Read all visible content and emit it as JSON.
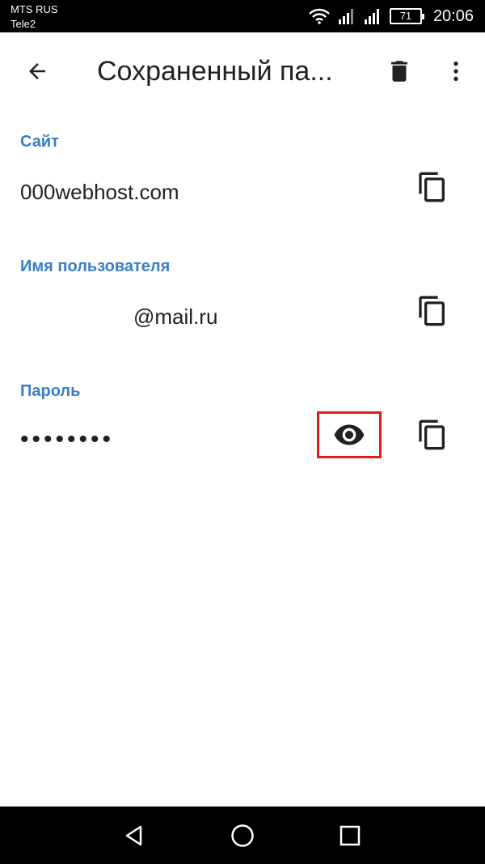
{
  "status_bar": {
    "carrier_primary": "MTS RUS",
    "carrier_secondary": "Tele2",
    "battery_level": "71",
    "time": "20:06",
    "icons": [
      "wifi-icon",
      "signal-icon",
      "signal-icon",
      "battery-icon"
    ]
  },
  "app_bar": {
    "title": "Сохраненный па...",
    "back_icon": "arrow-back-icon",
    "delete_icon": "trash-icon",
    "menu_icon": "more-vert-icon"
  },
  "site": {
    "label": "Сайт",
    "value": "000webhost.com",
    "copy_icon": "copy-icon"
  },
  "username": {
    "label": "Имя пользователя",
    "value": "@mail.ru",
    "copy_icon": "copy-icon"
  },
  "password": {
    "label": "Пароль",
    "value": "••••••••",
    "show_icon": "eye-icon",
    "copy_icon": "copy-icon"
  },
  "colors": {
    "accent": "#3a7fc4",
    "highlight": "#e11b1b",
    "text": "#212121",
    "bars": "#000000"
  },
  "nav_bar": {
    "icons": [
      "back-triangle-icon",
      "home-circle-icon",
      "recents-square-icon"
    ]
  }
}
